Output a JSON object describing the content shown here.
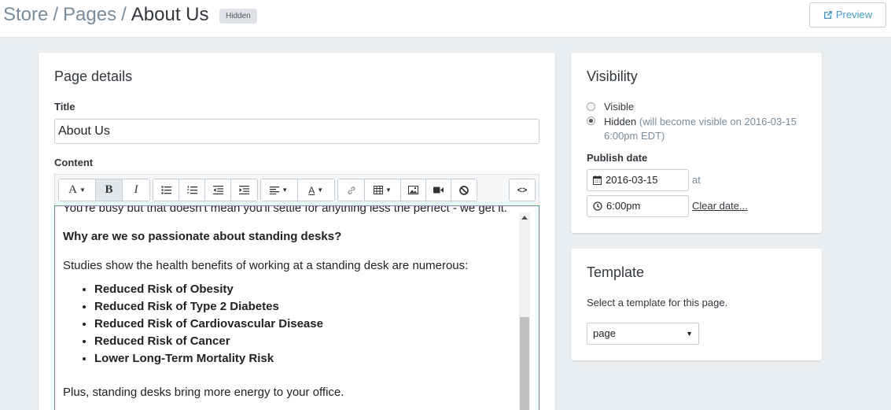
{
  "breadcrumb": {
    "store": "Store",
    "pages": "Pages",
    "current": "About Us",
    "separator": "/"
  },
  "status_badge": "Hidden",
  "preview_label": "Preview",
  "page_details": {
    "heading": "Page details",
    "title_label": "Title",
    "title_value": "About Us",
    "content_label": "Content"
  },
  "toolbar": {
    "code_label": "<>",
    "font_label": "A",
    "color_label": "A",
    "bold_label": "B",
    "italic_label": "I"
  },
  "editor": {
    "line1": "You're busy but that doesn't mean you'll settle for anything less the perfect - we get it.",
    "heading": "Why are we so passionate about standing desks?",
    "intro": "Studies show the health benefits of working at a standing desk are numerous:",
    "benefits": [
      "Reduced Risk of Obesity",
      "Reduced Risk of Type 2 Diabetes",
      "Reduced Risk of Cardiovascular Disease",
      "Reduced Risk of Cancer",
      "Lower Long-Term Mortality Risk"
    ],
    "outro": "Plus, standing desks bring more energy to your office."
  },
  "visibility": {
    "heading": "Visibility",
    "visible_label": "Visible",
    "hidden_label": "Hidden",
    "hidden_note": "(will become visible on 2016-03-15 6:00pm EDT)",
    "selected": "hidden",
    "publish_label": "Publish date",
    "date_value": "2016-03-15",
    "at_label": "at",
    "time_value": "6:00pm",
    "clear_label": "Clear date..."
  },
  "template": {
    "heading": "Template",
    "help_text": "Select a template for this page.",
    "selected": "page"
  },
  "colors": {
    "accent": "#479ccf",
    "background": "#ebeef0"
  }
}
